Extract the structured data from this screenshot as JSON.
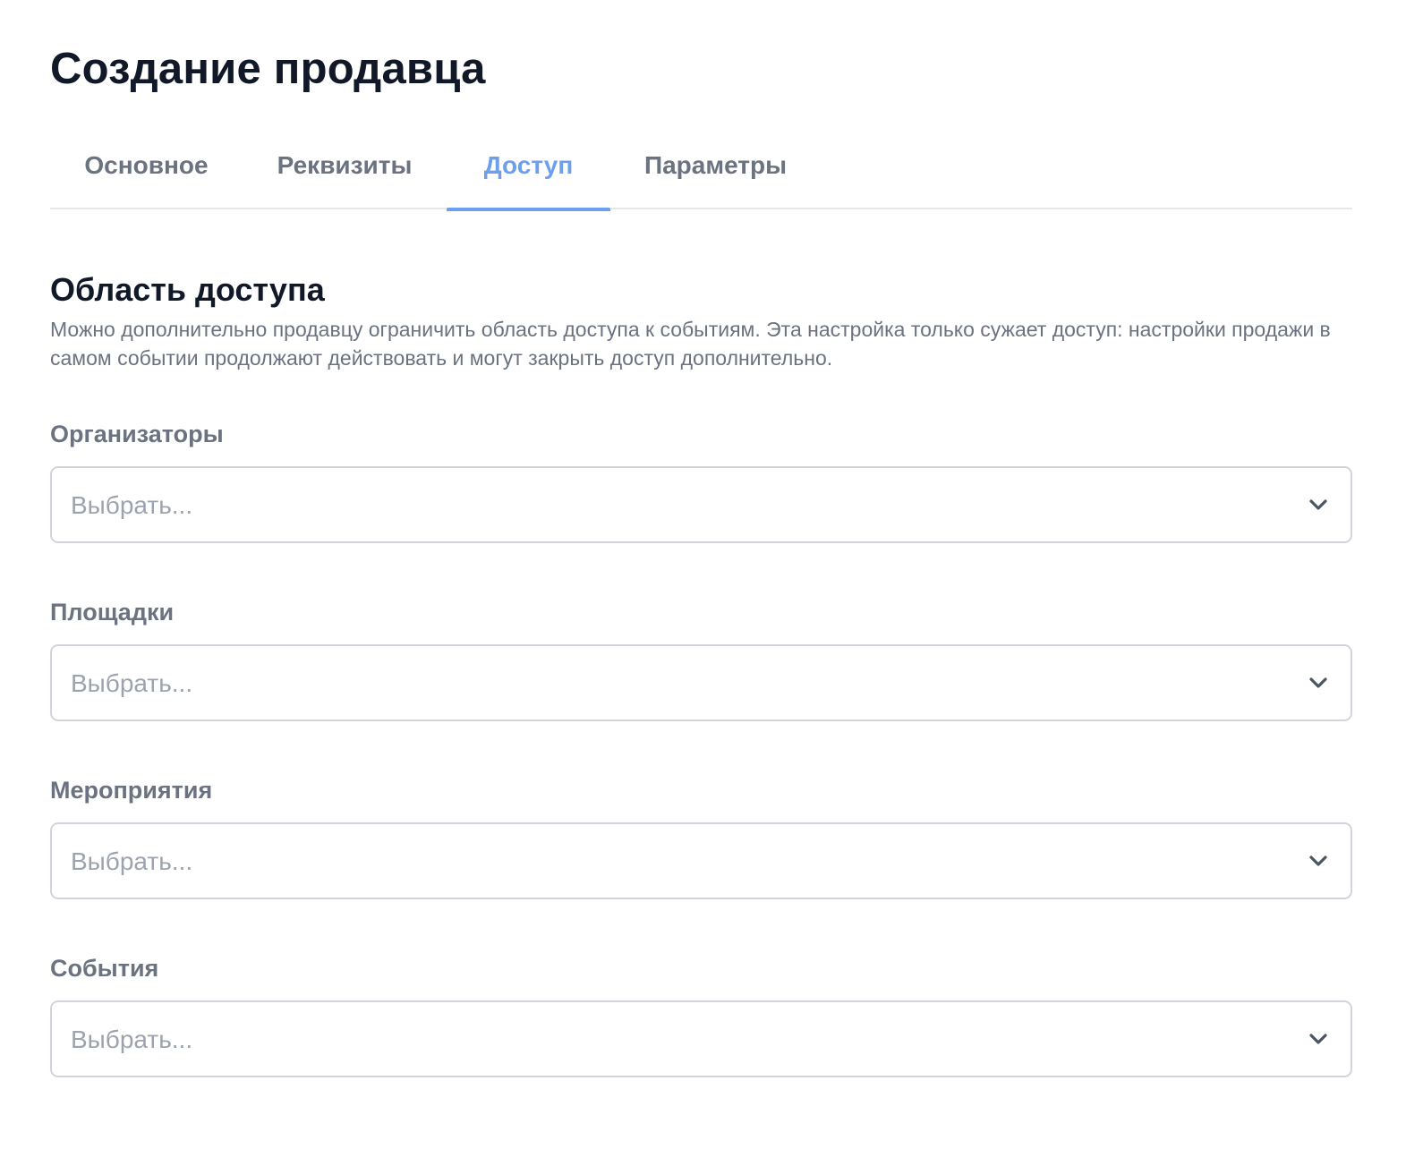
{
  "page": {
    "title": "Создание продавца"
  },
  "tabs": [
    {
      "label": "Основное"
    },
    {
      "label": "Реквизиты"
    },
    {
      "label": "Доступ",
      "active": true
    },
    {
      "label": "Параметры"
    }
  ],
  "section": {
    "title": "Область доступа",
    "description": "Можно дополнительно продавцу ограничить область доступа к событиям. Эта настройка только сужает доступ: настройки продажи в самом событии продолжают действовать и могут закрыть доступ дополнительно."
  },
  "fields": [
    {
      "label": "Организаторы",
      "placeholder": "Выбрать...",
      "icon": "chevron-down-icon"
    },
    {
      "label": "Площадки",
      "placeholder": "Выбрать...",
      "icon": "chevron-down-icon"
    },
    {
      "label": "Мероприятия",
      "placeholder": "Выбрать...",
      "icon": "chevron-down-icon"
    },
    {
      "label": "События",
      "placeholder": "Выбрать...",
      "icon": "chevron-down-icon"
    }
  ],
  "colors": {
    "accent": "#6ca0ee",
    "text": "#111827",
    "muted": "#6b7280",
    "placeholder": "#9ca3af",
    "border": "#d1d5db"
  }
}
